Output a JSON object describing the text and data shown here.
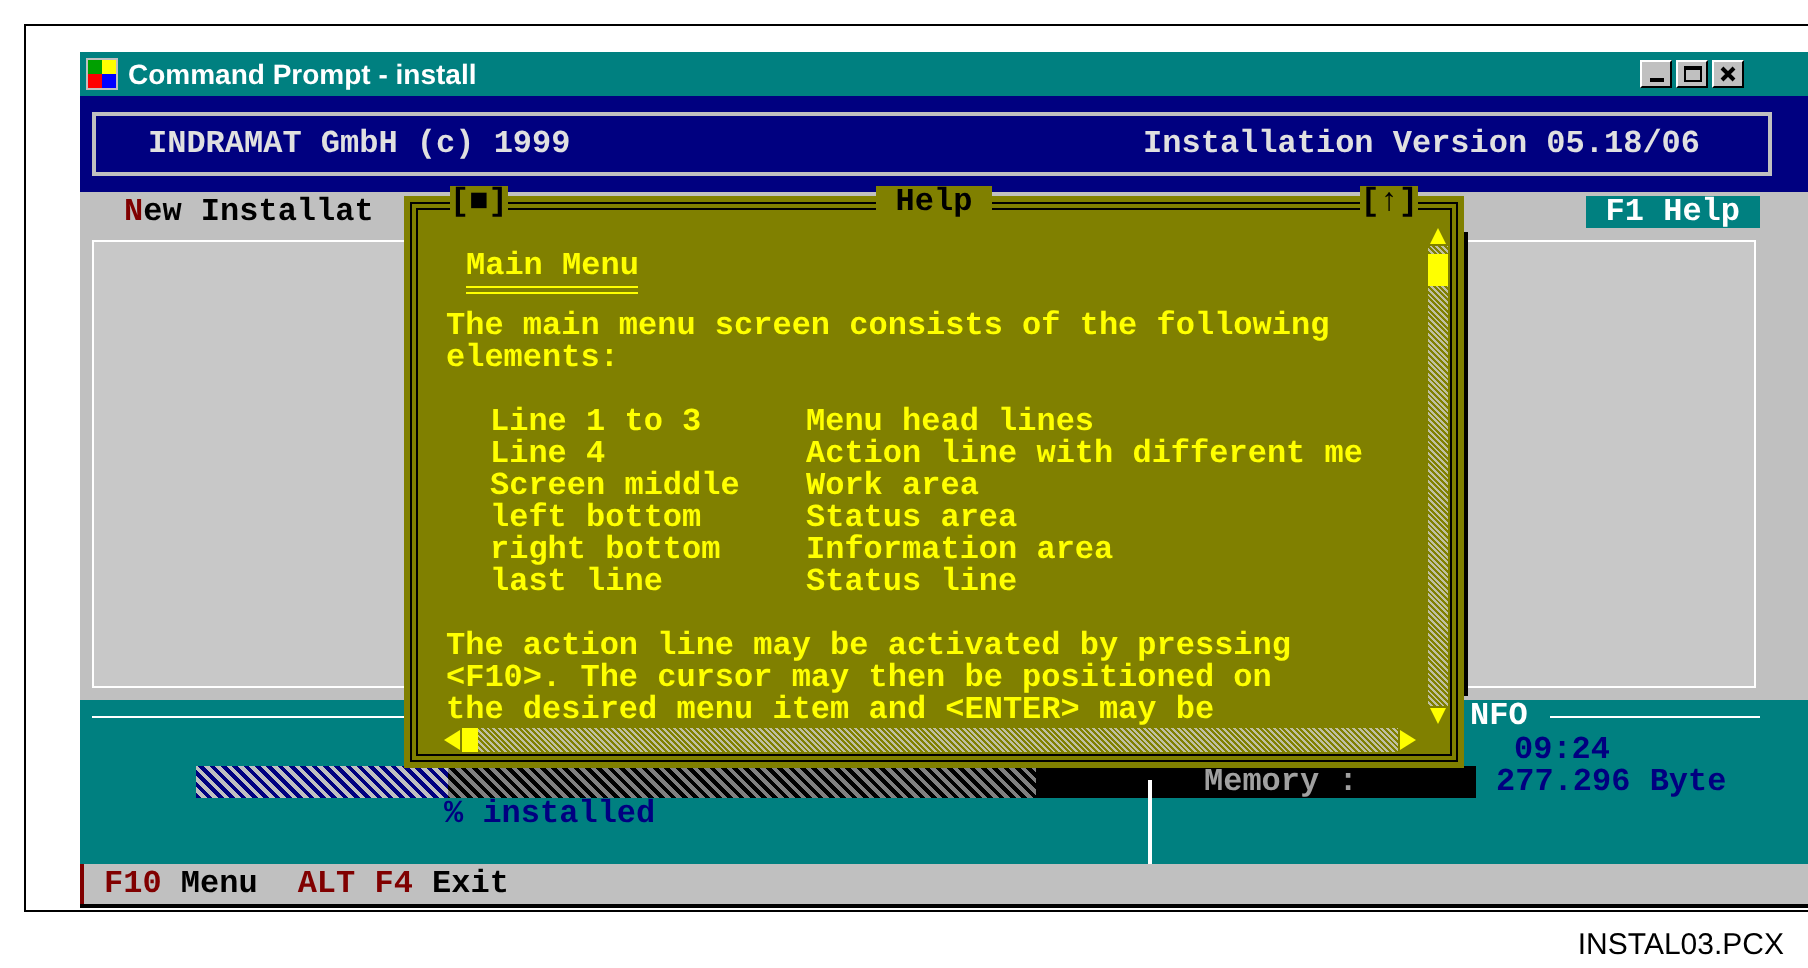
{
  "window": {
    "title": "Command Prompt - install"
  },
  "header": {
    "left": "INDRAMAT GmbH (c) 1999",
    "right": "Installation Version 05.18/06"
  },
  "action_line": {
    "items": [
      {
        "hotkey": "N",
        "rest": "ew Installat"
      }
    ],
    "help_key": {
      "key": "F1",
      "label": "Help"
    }
  },
  "help_dialog": {
    "close_glyph": "[■]",
    "title": "Help",
    "zoom_glyph": "[↑]",
    "heading": "Main Menu",
    "intro": [
      "The main menu screen consists of the following",
      "elements:"
    ],
    "rows": [
      {
        "term": "Line 1 to 3",
        "meaning": "Menu head lines"
      },
      {
        "term": "Line 4",
        "meaning": "Action line with different me"
      },
      {
        "term": "Screen middle",
        "meaning": "Work area"
      },
      {
        "term": "left bottom",
        "meaning": "Status area"
      },
      {
        "term": "right bottom",
        "meaning": "Information area"
      },
      {
        "term": "last line",
        "meaning": "Status line"
      }
    ],
    "outro": [
      "The action line may be activated by pressing",
      "<F10>. The cursor may then be positioned on",
      "the desired menu item and <ENTER> may be"
    ]
  },
  "status_area": {
    "info_label": "NFO",
    "time": "09:24",
    "progress": {
      "level": 0.3
    },
    "installed_label": "% installed",
    "memory_label": "Memory  :",
    "memory_value": "277.296 Byte"
  },
  "status_line": [
    {
      "key": "F10",
      "label": "Menu"
    },
    {
      "key": "ALT F4",
      "label": "Exit"
    }
  ],
  "caption": "INSTAL03.PCX"
}
